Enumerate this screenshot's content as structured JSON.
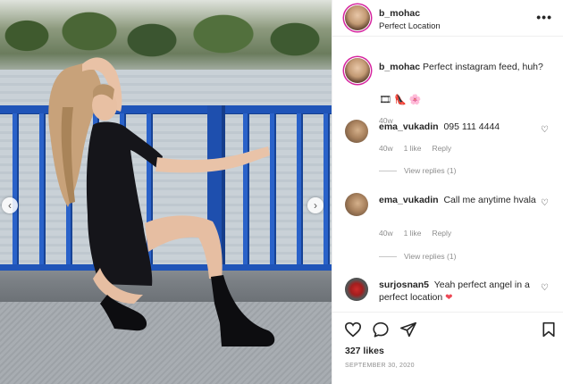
{
  "post": {
    "header": {
      "username": "b_mohac",
      "location": "Perfect Location",
      "more_icon": "more-dots-icon"
    },
    "caption": {
      "username": "b_mohac",
      "text": "Perfect instagram feed, huh?",
      "emojis": [
        "🎞",
        "👠",
        "🌸"
      ],
      "time": "40w"
    },
    "comments": [
      {
        "username": "ema_vukadin",
        "text": "095 111 4444",
        "time": "40w",
        "likes": "1 like",
        "reply": "Reply",
        "view_replies": "View replies (1)"
      },
      {
        "username": "ema_vukadin",
        "text": "Call me anytime hvala",
        "time": "40w",
        "likes": "1 like",
        "reply": "Reply",
        "view_replies": "View replies (1)"
      },
      {
        "username": "surjosnan5",
        "text": "Yeah perfect angel in a perfect location",
        "emoji": "❤"
      }
    ],
    "likes": "327 likes",
    "date": "SEPTEMBER 30, 2020"
  },
  "photo": {
    "prev_icon": "‹",
    "next_icon": "›"
  }
}
